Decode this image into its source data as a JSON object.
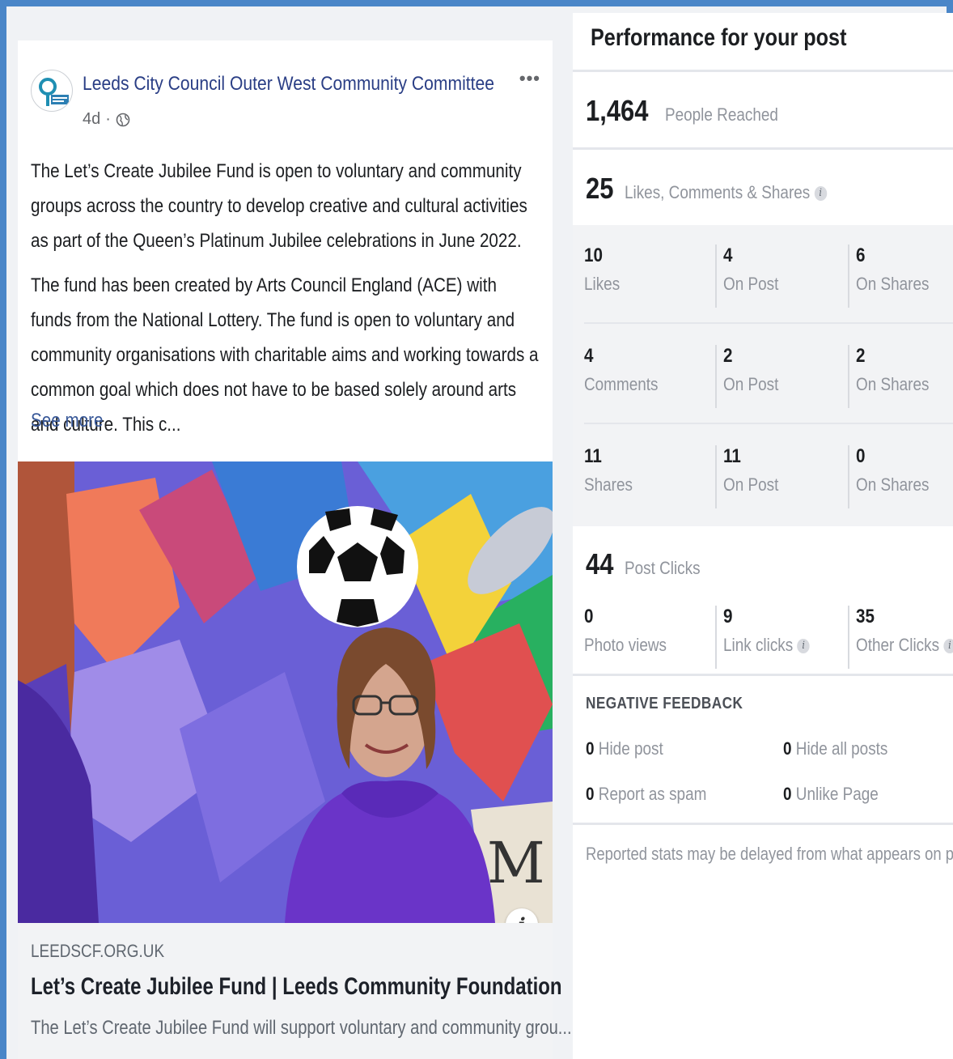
{
  "post": {
    "page_name": "Leeds City Council Outer West Community Committee",
    "time": "4d",
    "separator": "·",
    "more_icon": "more-options-icon",
    "paragraphs": [
      "The Let’s Create Jubilee Fund is open to voluntary and community groups across the country to develop creative and cultural activities as part of the Queen’s Platinum Jubilee celebrations in June 2022.",
      "The fund has been created by Arts Council England (ACE) with funds from the National Lottery. The fund is open to voluntary and community organisations with charitable aims and working towards a common goal which does not have to be based solely around arts and culture. This c..."
    ],
    "see_more": "See more",
    "link": {
      "domain": "LEEDSCF.ORG.UK",
      "title": "Let’s Create Jubilee Fund | Leeds Community Foundation",
      "description": "The Let’s Create Jubilee Fund will support voluntary and community grou..."
    }
  },
  "panel": {
    "title": "Performance for your post",
    "reached": {
      "value": "1,464",
      "label": "People Reached"
    },
    "engagement": {
      "value": "25",
      "label": "Likes, Comments & Shares"
    },
    "rows": [
      {
        "cells": [
          {
            "num": "10",
            "lbl": "Likes"
          },
          {
            "num": "4",
            "lbl": "On Post"
          },
          {
            "num": "6",
            "lbl": "On Shares"
          }
        ]
      },
      {
        "cells": [
          {
            "num": "4",
            "lbl": "Comments"
          },
          {
            "num": "2",
            "lbl": "On Post"
          },
          {
            "num": "2",
            "lbl": "On Shares"
          }
        ]
      },
      {
        "cells": [
          {
            "num": "11",
            "lbl": "Shares"
          },
          {
            "num": "11",
            "lbl": "On Post"
          },
          {
            "num": "0",
            "lbl": "On Shares"
          }
        ]
      }
    ],
    "post_clicks": {
      "value": "44",
      "label": "Post Clicks",
      "cells": [
        {
          "num": "0",
          "lbl": "Photo views"
        },
        {
          "num": "9",
          "lbl": "Link clicks"
        },
        {
          "num": "35",
          "lbl": "Other Clicks"
        }
      ]
    },
    "negative": {
      "title": "NEGATIVE FEEDBACK",
      "items": [
        {
          "num": "0",
          "lbl": "Hide post"
        },
        {
          "num": "0",
          "lbl": "Hide all posts"
        },
        {
          "num": "0",
          "lbl": "Report as spam"
        },
        {
          "num": "0",
          "lbl": "Unlike Page"
        }
      ]
    },
    "footnote": "Reported stats may be delayed from what appears on posts"
  },
  "colors": {
    "frame": "#4a86c8",
    "link": "#385898",
    "page_name": "#2a3e85"
  }
}
